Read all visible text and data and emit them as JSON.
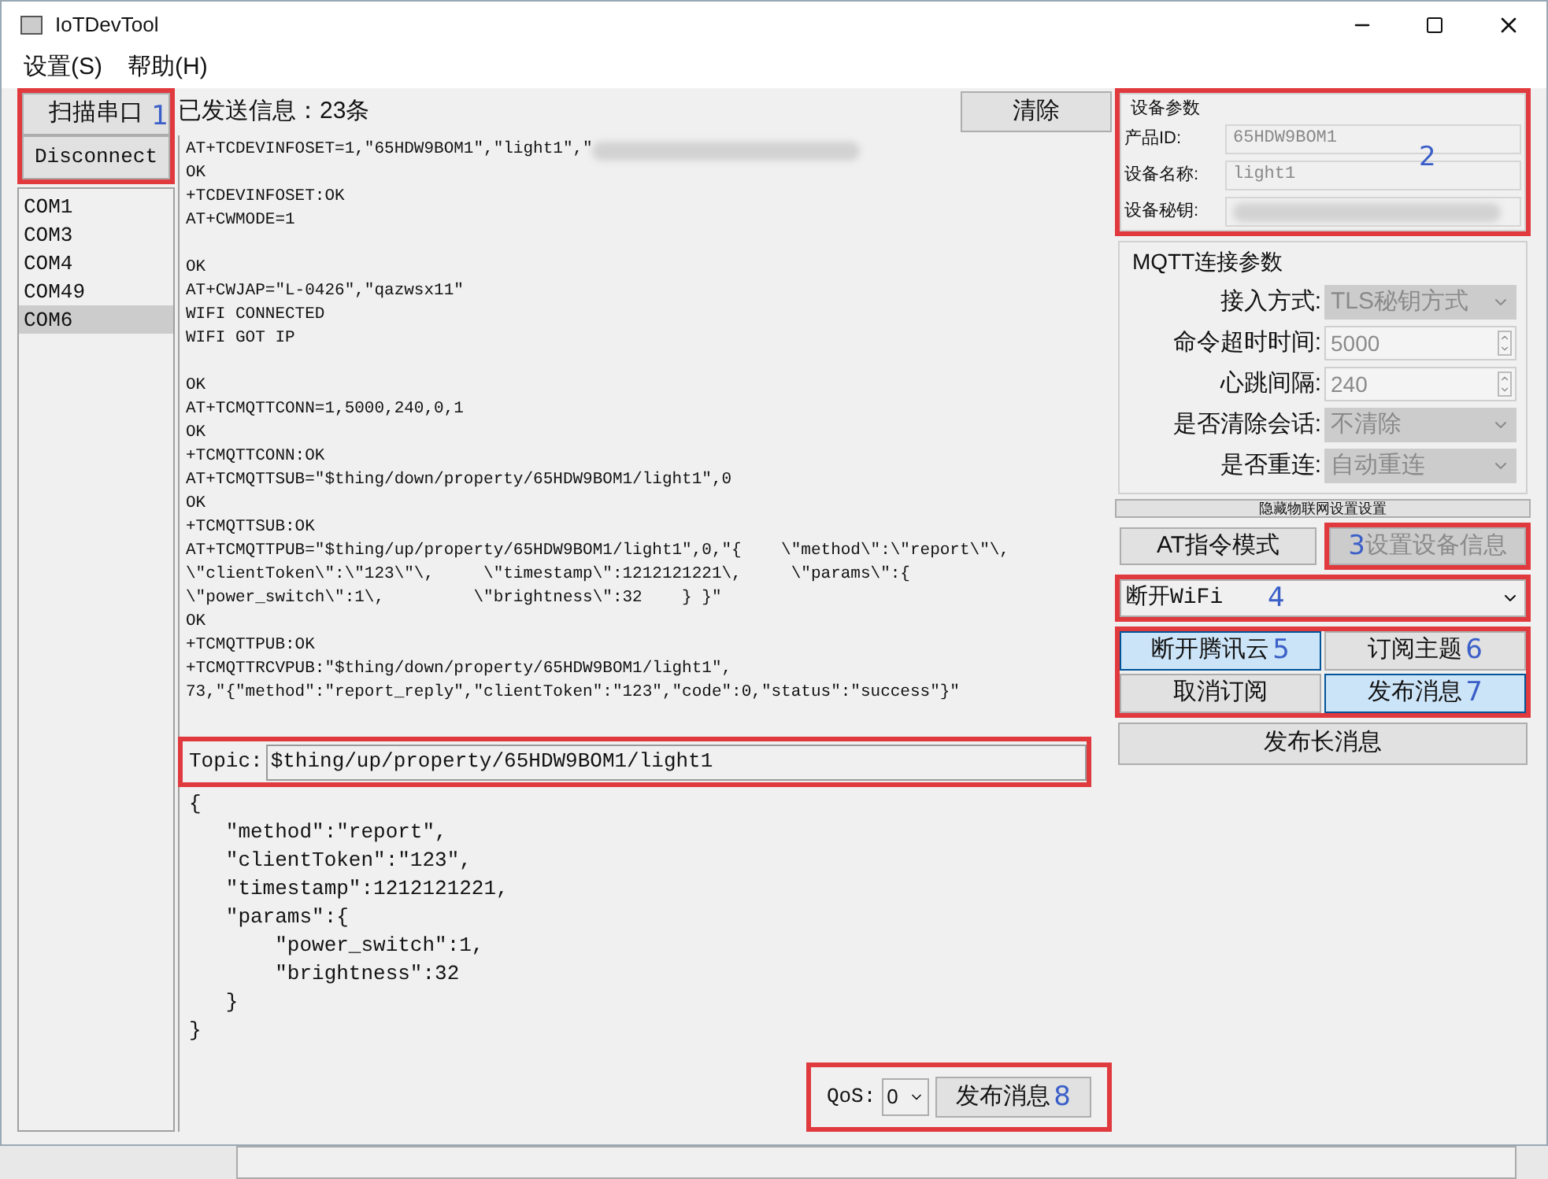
{
  "window": {
    "title": "IoTDevTool"
  },
  "menu": [
    {
      "label": "设置(S)"
    },
    {
      "label": "帮助(H)"
    }
  ],
  "left_panel": {
    "highlight": true,
    "annotation": "1",
    "scan_button": "扫描串口",
    "disconnect_button": "Disconnect",
    "ports": [
      {
        "label": "COM1",
        "selected": false
      },
      {
        "label": "COM3",
        "selected": false
      },
      {
        "label": "COM4",
        "selected": false
      },
      {
        "label": "COM49",
        "selected": false
      },
      {
        "label": "COM6",
        "selected": true
      }
    ]
  },
  "log": {
    "sent_count": "已发送信息：23条",
    "clear_button": "清除",
    "lines": [
      {
        "kind": "text",
        "text": "AT+TCDEVINFOSET=1,\"65HDW9BOM1\",\"light1\",\"",
        "redacted": true
      },
      {
        "kind": "text",
        "text": "OK"
      },
      {
        "kind": "text",
        "text": "+TCDEVINFOSET:OK"
      },
      {
        "kind": "text",
        "text": "AT+CWMODE=1"
      },
      {
        "kind": "blank"
      },
      {
        "kind": "text",
        "text": "OK"
      },
      {
        "kind": "text",
        "text": "AT+CWJAP=\"L-0426\",\"qazwsx11\""
      },
      {
        "kind": "text",
        "text": "WIFI CONNECTED"
      },
      {
        "kind": "text",
        "text": "WIFI GOT IP"
      },
      {
        "kind": "blank"
      },
      {
        "kind": "text",
        "text": "OK"
      },
      {
        "kind": "text",
        "text": "AT+TCMQTTCONN=1,5000,240,0,1"
      },
      {
        "kind": "text",
        "text": "OK"
      },
      {
        "kind": "text",
        "text": "+TCMQTTCONN:OK"
      },
      {
        "kind": "text",
        "text": "AT+TCMQTTSUB=\"$thing/down/property/65HDW9BOM1/light1\",0"
      },
      {
        "kind": "text",
        "text": "OK"
      },
      {
        "kind": "text",
        "text": "+TCMQTTSUB:OK"
      },
      {
        "kind": "text",
        "text": "AT+TCMQTTPUB=\"$thing/up/property/65HDW9BOM1/light1\",0,\"{    \\\"method\\\":\\\"report\\\"\\,"
      },
      {
        "kind": "text",
        "text": "\\\"clientToken\\\":\\\"123\\\"\\,     \\\"timestamp\\\":1212121221\\,     \\\"params\\\":{"
      },
      {
        "kind": "text",
        "text": "\\\"power_switch\\\":1\\,         \\\"brightness\\\":32    } }\""
      },
      {
        "kind": "text",
        "text": "OK"
      },
      {
        "kind": "text",
        "text": "+TCMQTTPUB:OK"
      },
      {
        "kind": "text",
        "text": "+TCMQTTRCVPUB:\"$thing/down/property/65HDW9BOM1/light1\","
      },
      {
        "kind": "text",
        "text": "73,\"{\"method\":\"report_reply\",\"clientToken\":\"123\",\"code\":0,\"status\":\"success\"}\""
      }
    ]
  },
  "topic": {
    "highlight": true,
    "label": "Topic:",
    "value": "$thing/up/property/65HDW9BOM1/light1"
  },
  "payload": {
    "lines": [
      "{",
      "   \"method\":\"report\",",
      "   \"clientToken\":\"123\",",
      "   \"timestamp\":1212121221,",
      "   \"params\":{",
      "       \"power_switch\":1,",
      "       \"brightness\":32",
      "   }",
      "}"
    ]
  },
  "publish_bar": {
    "highlight": true,
    "annotation": "8",
    "qos_label": "QoS:",
    "qos_value": "0",
    "publish_button": "发布消息"
  },
  "device_params": {
    "highlight": true,
    "annotation": "2",
    "title": "设备参数",
    "fields": [
      {
        "label": "产品ID:",
        "value": "65HDW9BOM1"
      },
      {
        "label": "设备名称:",
        "value": "light1"
      },
      {
        "label": "设备秘钥:",
        "redacted": true
      }
    ]
  },
  "mqtt_params": {
    "title": "MQTT连接参数",
    "rows": [
      {
        "kind": "select",
        "label": "接入方式:",
        "value": "TLS秘钥方式",
        "disabled": true
      },
      {
        "kind": "spin",
        "label": "命令超时时间:",
        "value": "5000",
        "disabled": false
      },
      {
        "kind": "spin",
        "label": "心跳间隔:",
        "value": "240",
        "disabled": false
      },
      {
        "kind": "select",
        "label": "是否清除会话:",
        "value": "不清除",
        "disabled": true
      },
      {
        "kind": "select",
        "label": "是否重连:",
        "value": "自动重连",
        "disabled": true
      }
    ]
  },
  "hide_settings_button": "隐藏物联网设置设置",
  "mode_buttons": [
    {
      "label": "AT指令模式",
      "disabled": false,
      "highlight": false
    },
    {
      "label": "设置设备信息",
      "disabled": true,
      "highlight": true,
      "annotation": "3"
    }
  ],
  "wifi_select": {
    "highlight": true,
    "annotation": "4",
    "value": "断开WiFi"
  },
  "action_group": {
    "highlight": true,
    "buttons": [
      {
        "label": "断开腾讯云",
        "annotation": "5",
        "selected": true
      },
      {
        "label": "订阅主题",
        "annotation": "6",
        "selected": false
      },
      {
        "label": "取消订阅",
        "selected": false
      },
      {
        "label": "发布消息",
        "annotation": "7",
        "selected": true
      }
    ]
  },
  "long_publish_button": "发布长消息"
}
